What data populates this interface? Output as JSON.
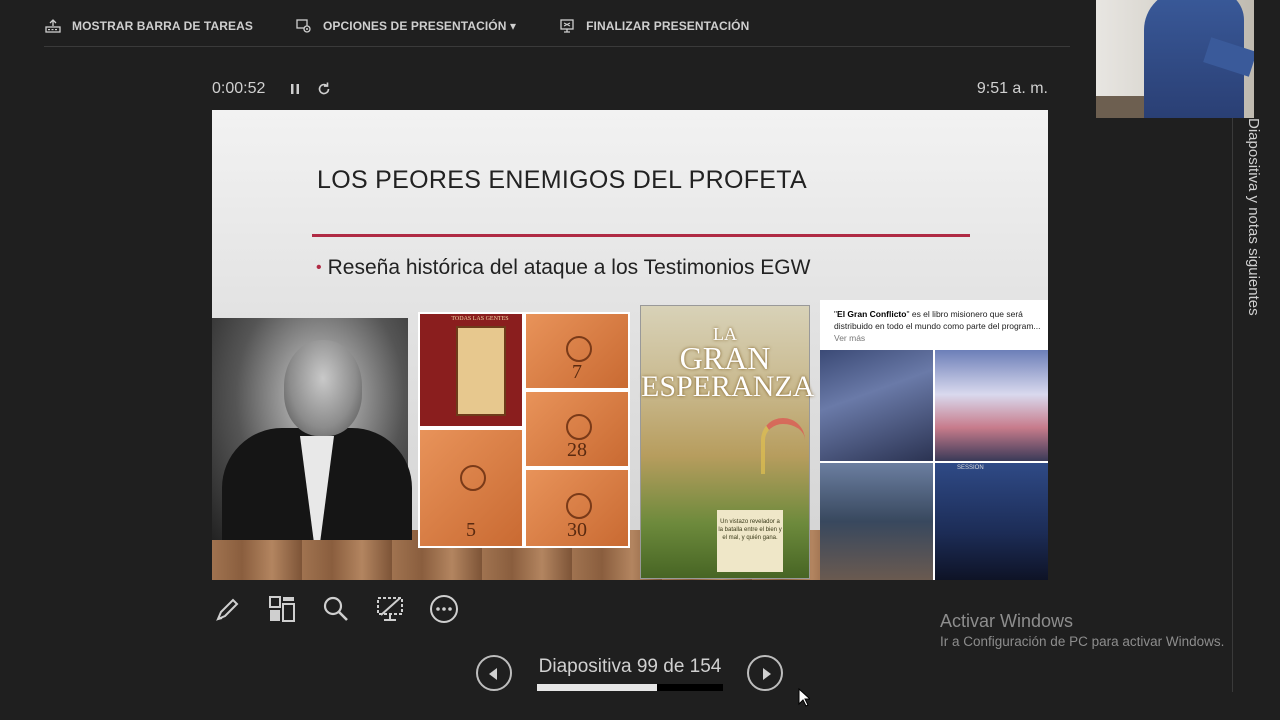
{
  "toolbar": {
    "taskbar_label": "MOSTRAR BARRA DE TAREAS",
    "options_label": "OPCIONES DE PRESENTACIÓN ▾",
    "end_label": "FINALIZAR PRESENTACIÓN"
  },
  "timer": {
    "elapsed": "0:00:52",
    "clock": "9:51 a. m."
  },
  "slide": {
    "title": "LOS PEORES ENEMIGOS DEL PROFETA",
    "bullet": "Reseña histórica del ataque a los Testimonios EGW",
    "books": {
      "cover_caption": "TODAS LAS GENTES",
      "vol1": "7",
      "vol2": "28",
      "vol3": "5",
      "vol4": "30"
    },
    "cover": {
      "line1": "LA",
      "line2": "GRAN",
      "line3": "ESPERANZA",
      "tagline": "Un vistazo revelador a la batalla entre el bien y el mal, y quién gana."
    },
    "collage": {
      "caption_bold": "El Gran Conflicto",
      "caption_rest": " es el libro misionero que será distribuido en todo el mundo como parte del program...",
      "more": " Ver más",
      "session": "SESSION"
    }
  },
  "navigation": {
    "slide_counter": "Diapositiva 99 de 154",
    "progress": 0.643
  },
  "side_panel": {
    "label": "Diapositiva y notas siguientes"
  },
  "watermark": {
    "title": "Activar Windows",
    "subtitle": "Ir a Configuración de PC para activar Windows."
  }
}
